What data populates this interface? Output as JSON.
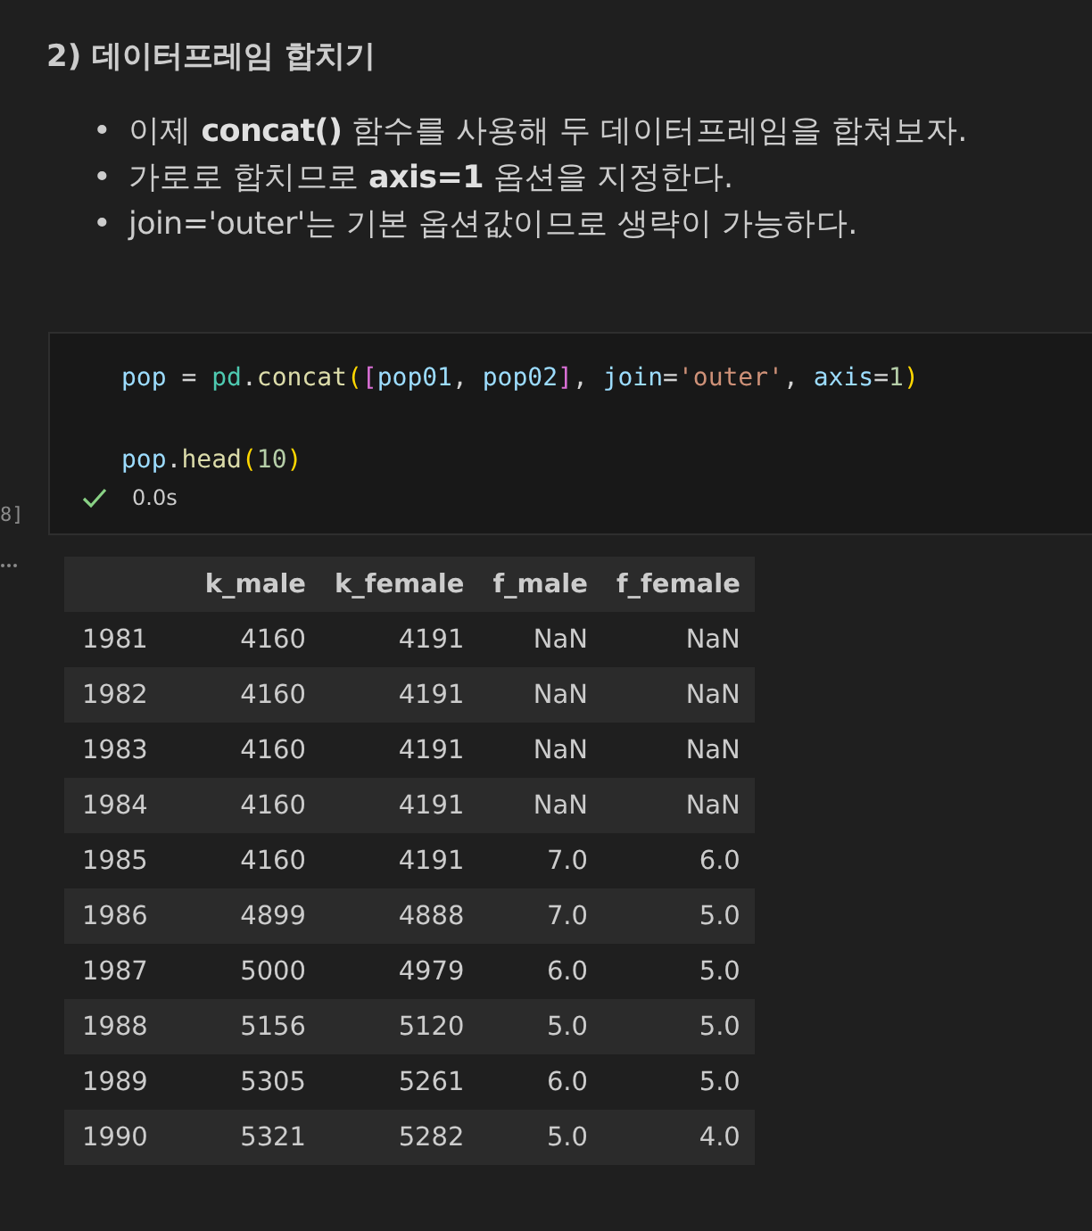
{
  "heading": "2) 데이터프레임 합치기",
  "bullets": [
    {
      "marker": "•",
      "text": "이제 **concat()** 함수를 사용해 두 데이터프레임을 합쳐보자."
    },
    {
      "marker": "•",
      "text": "가로로 합치므로 **axis=1** 옵션을 지정한다."
    },
    {
      "marker": "•",
      "text": "join='outer'는 기본 옵션값이므로 생략이 가능하다."
    }
  ],
  "cell": {
    "execution_count": "8]",
    "code_lines": [
      [
        {
          "text": "pop",
          "kind": "var"
        },
        {
          "text": " = ",
          "kind": "op"
        },
        {
          "text": "pd",
          "kind": "mod"
        },
        {
          "text": ".",
          "kind": "op"
        },
        {
          "text": "concat",
          "kind": "fn"
        },
        {
          "text": "(",
          "kind": "br1"
        },
        {
          "text": "[",
          "kind": "br2"
        },
        {
          "text": "pop01",
          "kind": "var"
        },
        {
          "text": ", ",
          "kind": "op"
        },
        {
          "text": "pop02",
          "kind": "var"
        },
        {
          "text": "]",
          "kind": "br2"
        },
        {
          "text": ", ",
          "kind": "op"
        },
        {
          "text": "join",
          "kind": "var"
        },
        {
          "text": "=",
          "kind": "op"
        },
        {
          "text": "'outer'",
          "kind": "str"
        },
        {
          "text": ", ",
          "kind": "op"
        },
        {
          "text": "axis",
          "kind": "var"
        },
        {
          "text": "=",
          "kind": "op"
        },
        {
          "text": "1",
          "kind": "num"
        },
        {
          "text": ")",
          "kind": "br1"
        }
      ],
      [
        {
          "text": "pop",
          "kind": "var"
        },
        {
          "text": ".",
          "kind": "op"
        },
        {
          "text": "head",
          "kind": "fn"
        },
        {
          "text": "(",
          "kind": "br1"
        },
        {
          "text": "10",
          "kind": "num"
        },
        {
          "text": ")",
          "kind": "br1"
        }
      ]
    ],
    "succeeded": true,
    "duration": "0.0s"
  },
  "table": {
    "columns": [
      "",
      "k_male",
      "k_female",
      "f_male",
      "f_female"
    ],
    "rows": [
      [
        "1981",
        "4160",
        "4191",
        "NaN",
        "NaN"
      ],
      [
        "1982",
        "4160",
        "4191",
        "NaN",
        "NaN"
      ],
      [
        "1983",
        "4160",
        "4191",
        "NaN",
        "NaN"
      ],
      [
        "1984",
        "4160",
        "4191",
        "NaN",
        "NaN"
      ],
      [
        "1985",
        "4160",
        "4191",
        "7.0",
        "6.0"
      ],
      [
        "1986",
        "4899",
        "4888",
        "7.0",
        "5.0"
      ],
      [
        "1987",
        "5000",
        "4979",
        "6.0",
        "5.0"
      ],
      [
        "1988",
        "5156",
        "5120",
        "5.0",
        "5.0"
      ],
      [
        "1989",
        "5305",
        "5261",
        "6.0",
        "5.0"
      ],
      [
        "1990",
        "5321",
        "5282",
        "5.0",
        "4.0"
      ]
    ]
  }
}
